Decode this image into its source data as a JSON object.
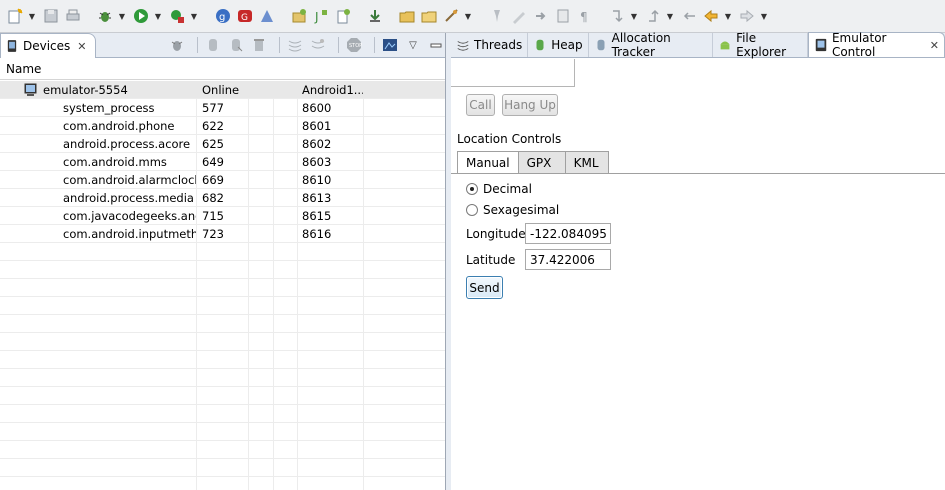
{
  "toolbar": {
    "icons": [
      "new-wizard-icon",
      "save-icon",
      "print-icon",
      "debug-icon",
      "run-icon",
      "external-tools-icon",
      "google-icon",
      "gwt-icon",
      "sdk-icon",
      "new-android-project-icon",
      "new-java-class-icon",
      "new-xml-file-icon",
      "download-icon",
      "open-folder-icon",
      "open-type-icon",
      "search-icon",
      "pin-icon",
      "edit-pen-icon",
      "next-annotation-icon",
      "show-whitespace-icon",
      "show-paragraph-icon",
      "next-edit-icon",
      "prev-edit-icon",
      "back-icon",
      "forward-icon"
    ]
  },
  "devices_view": {
    "tab_label": "Devices",
    "tool_icons": [
      "debug-process-icon",
      "update-heap-icon",
      "dump-hprof-icon",
      "cause-gc-icon",
      "update-threads-icon",
      "start-method-profiling-icon",
      "stop-process-icon",
      "screen-capture-icon",
      "view-menu-icon",
      "minimize-icon",
      "maximize-icon"
    ],
    "column_header": "Name",
    "device": {
      "name": "emulator-5554",
      "status": "Online",
      "target": "Android1..."
    },
    "processes": [
      {
        "name": "system_process",
        "pid": "577",
        "port": "8600"
      },
      {
        "name": "com.android.phone",
        "pid": "622",
        "port": "8601"
      },
      {
        "name": "android.process.acore",
        "pid": "625",
        "port": "8602"
      },
      {
        "name": "com.android.mms",
        "pid": "649",
        "port": "8603"
      },
      {
        "name": "com.android.alarmclock",
        "pid": "669",
        "port": "8610"
      },
      {
        "name": "android.process.media",
        "pid": "682",
        "port": "8613"
      },
      {
        "name": "com.javacodegeeks.andro",
        "pid": "715",
        "port": "8615"
      },
      {
        "name": "com.android.inputmetho",
        "pid": "723",
        "port": "8616"
      }
    ]
  },
  "right_tabs": [
    {
      "label": "Threads",
      "icon": "threads-icon"
    },
    {
      "label": "Heap",
      "icon": "heap-icon"
    },
    {
      "label": "Allocation Tracker",
      "icon": "allocation-icon"
    },
    {
      "label": "File Explorer",
      "icon": "android-icon"
    },
    {
      "label": "Emulator Control",
      "icon": "emulator-icon",
      "active": true,
      "close": "✕"
    }
  ],
  "emulator_control": {
    "call_label": "Call",
    "hangup_label": "Hang Up",
    "location_title": "Location Controls",
    "subtabs": [
      "Manual",
      "GPX",
      "KML"
    ],
    "decimal_label": "Decimal",
    "sexagesimal_label": "Sexagesimal",
    "longitude_label": "Longitude",
    "longitude_value": "-122.084095",
    "latitude_label": "Latitude",
    "latitude_value": "37.422006",
    "send_label": "Send"
  },
  "close_glyph": "✕"
}
